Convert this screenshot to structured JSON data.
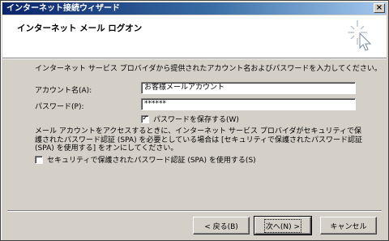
{
  "window": {
    "title": "インターネット接続ウィザード",
    "close_glyph": "×"
  },
  "header": {
    "title": "インターネット メール ログオン"
  },
  "intro": "インターネット サービス プロバイダから提供されたアカウント名およびパスワードを入力してください。",
  "account": {
    "label": "アカウント名(A):",
    "value": "お客様メールアカウント"
  },
  "password": {
    "label": "パスワード(P):",
    "value": "******"
  },
  "save_password": {
    "label": "パスワードを保存する(W)",
    "checked": true,
    "mark": "✓"
  },
  "spa_description": "メール アカウントをアクセスするときに、インターネット サービス プロバイダがセキュリティで保護されたパスワード認証 (SPA) を必要としている場合は [セキュリティで保護されたパスワード認証 (SPA) を使用する] をオンにしてください。",
  "spa": {
    "label": "セキュリティで保護されたパスワード認証 (SPA) を使用する(S)",
    "checked": false
  },
  "buttons": {
    "back": "< 戻る(B)",
    "next": "次へ(N) >",
    "cancel": "キャンセル"
  }
}
